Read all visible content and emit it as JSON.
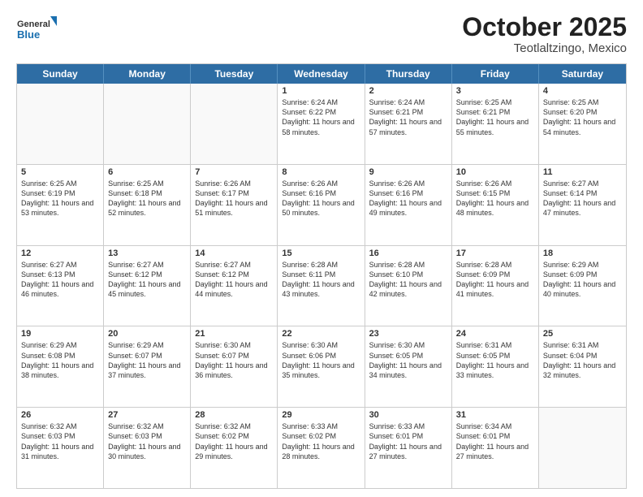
{
  "header": {
    "logo_general": "General",
    "logo_blue": "Blue",
    "title": "October 2025",
    "subtitle": "Teotlaltzingo, Mexico"
  },
  "days": [
    "Sunday",
    "Monday",
    "Tuesday",
    "Wednesday",
    "Thursday",
    "Friday",
    "Saturday"
  ],
  "weeks": [
    [
      {
        "day": "",
        "empty": true
      },
      {
        "day": "",
        "empty": true
      },
      {
        "day": "",
        "empty": true
      },
      {
        "day": "1",
        "sunrise": "6:24 AM",
        "sunset": "6:22 PM",
        "daylight": "11 hours and 58 minutes."
      },
      {
        "day": "2",
        "sunrise": "6:24 AM",
        "sunset": "6:21 PM",
        "daylight": "11 hours and 57 minutes."
      },
      {
        "day": "3",
        "sunrise": "6:25 AM",
        "sunset": "6:21 PM",
        "daylight": "11 hours and 55 minutes."
      },
      {
        "day": "4",
        "sunrise": "6:25 AM",
        "sunset": "6:20 PM",
        "daylight": "11 hours and 54 minutes."
      }
    ],
    [
      {
        "day": "5",
        "sunrise": "6:25 AM",
        "sunset": "6:19 PM",
        "daylight": "11 hours and 53 minutes."
      },
      {
        "day": "6",
        "sunrise": "6:25 AM",
        "sunset": "6:18 PM",
        "daylight": "11 hours and 52 minutes."
      },
      {
        "day": "7",
        "sunrise": "6:26 AM",
        "sunset": "6:17 PM",
        "daylight": "11 hours and 51 minutes."
      },
      {
        "day": "8",
        "sunrise": "6:26 AM",
        "sunset": "6:16 PM",
        "daylight": "11 hours and 50 minutes."
      },
      {
        "day": "9",
        "sunrise": "6:26 AM",
        "sunset": "6:16 PM",
        "daylight": "11 hours and 49 minutes."
      },
      {
        "day": "10",
        "sunrise": "6:26 AM",
        "sunset": "6:15 PM",
        "daylight": "11 hours and 48 minutes."
      },
      {
        "day": "11",
        "sunrise": "6:27 AM",
        "sunset": "6:14 PM",
        "daylight": "11 hours and 47 minutes."
      }
    ],
    [
      {
        "day": "12",
        "sunrise": "6:27 AM",
        "sunset": "6:13 PM",
        "daylight": "11 hours and 46 minutes."
      },
      {
        "day": "13",
        "sunrise": "6:27 AM",
        "sunset": "6:12 PM",
        "daylight": "11 hours and 45 minutes."
      },
      {
        "day": "14",
        "sunrise": "6:27 AM",
        "sunset": "6:12 PM",
        "daylight": "11 hours and 44 minutes."
      },
      {
        "day": "15",
        "sunrise": "6:28 AM",
        "sunset": "6:11 PM",
        "daylight": "11 hours and 43 minutes."
      },
      {
        "day": "16",
        "sunrise": "6:28 AM",
        "sunset": "6:10 PM",
        "daylight": "11 hours and 42 minutes."
      },
      {
        "day": "17",
        "sunrise": "6:28 AM",
        "sunset": "6:09 PM",
        "daylight": "11 hours and 41 minutes."
      },
      {
        "day": "18",
        "sunrise": "6:29 AM",
        "sunset": "6:09 PM",
        "daylight": "11 hours and 40 minutes."
      }
    ],
    [
      {
        "day": "19",
        "sunrise": "6:29 AM",
        "sunset": "6:08 PM",
        "daylight": "11 hours and 38 minutes."
      },
      {
        "day": "20",
        "sunrise": "6:29 AM",
        "sunset": "6:07 PM",
        "daylight": "11 hours and 37 minutes."
      },
      {
        "day": "21",
        "sunrise": "6:30 AM",
        "sunset": "6:07 PM",
        "daylight": "11 hours and 36 minutes."
      },
      {
        "day": "22",
        "sunrise": "6:30 AM",
        "sunset": "6:06 PM",
        "daylight": "11 hours and 35 minutes."
      },
      {
        "day": "23",
        "sunrise": "6:30 AM",
        "sunset": "6:05 PM",
        "daylight": "11 hours and 34 minutes."
      },
      {
        "day": "24",
        "sunrise": "6:31 AM",
        "sunset": "6:05 PM",
        "daylight": "11 hours and 33 minutes."
      },
      {
        "day": "25",
        "sunrise": "6:31 AM",
        "sunset": "6:04 PM",
        "daylight": "11 hours and 32 minutes."
      }
    ],
    [
      {
        "day": "26",
        "sunrise": "6:32 AM",
        "sunset": "6:03 PM",
        "daylight": "11 hours and 31 minutes."
      },
      {
        "day": "27",
        "sunrise": "6:32 AM",
        "sunset": "6:03 PM",
        "daylight": "11 hours and 30 minutes."
      },
      {
        "day": "28",
        "sunrise": "6:32 AM",
        "sunset": "6:02 PM",
        "daylight": "11 hours and 29 minutes."
      },
      {
        "day": "29",
        "sunrise": "6:33 AM",
        "sunset": "6:02 PM",
        "daylight": "11 hours and 28 minutes."
      },
      {
        "day": "30",
        "sunrise": "6:33 AM",
        "sunset": "6:01 PM",
        "daylight": "11 hours and 27 minutes."
      },
      {
        "day": "31",
        "sunrise": "6:34 AM",
        "sunset": "6:01 PM",
        "daylight": "11 hours and 27 minutes."
      },
      {
        "day": "",
        "empty": true
      }
    ]
  ],
  "labels": {
    "sunrise": "Sunrise:",
    "sunset": "Sunset:",
    "daylight": "Daylight:"
  }
}
